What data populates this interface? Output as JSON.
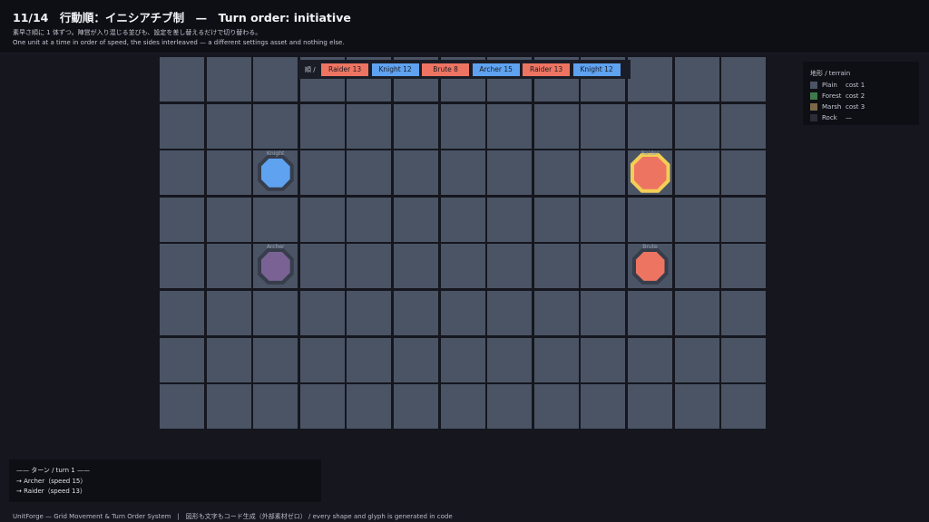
{
  "header": {
    "title": "11/14　行動順：イニシアチブ制　—　Turn order: initiative",
    "subtitle_ja": "素早さ順に 1 体ずつ。陣営が入り混じる並びも、設定を差し替えるだけで切り替わる。",
    "subtitle_en": "One unit at a time in order of speed, the sides interleaved — a different settings asset and nothing else."
  },
  "turn_order": {
    "label": "順 /",
    "queue": [
      {
        "name": "Raider",
        "speed": 13,
        "label": "Raider 13",
        "side": "enemy"
      },
      {
        "name": "Knight",
        "speed": 12,
        "label": "Knight 12",
        "side": "ally"
      },
      {
        "name": "Brute",
        "speed": 8,
        "label": "Brute 8",
        "side": "enemy"
      },
      {
        "name": "Archer",
        "speed": 15,
        "label": "Archer 15",
        "side": "ally"
      },
      {
        "name": "Raider",
        "speed": 13,
        "label": "Raider 13",
        "side": "enemy"
      },
      {
        "name": "Knight",
        "speed": 12,
        "label": "Knight 12",
        "side": "ally"
      }
    ]
  },
  "board": {
    "cols": 13,
    "rows": 8,
    "units": [
      {
        "name": "Knight",
        "col": 2,
        "row": 2,
        "side": "ally",
        "color": "#5ea2f0",
        "active": false
      },
      {
        "name": "Raider",
        "col": 10,
        "row": 2,
        "side": "enemy",
        "color": "#ee7462",
        "active": true
      },
      {
        "name": "Archer",
        "col": 2,
        "row": 4,
        "side": "ally",
        "color": "#7a6394",
        "active": false
      },
      {
        "name": "Brute",
        "col": 10,
        "row": 4,
        "side": "enemy",
        "color": "#ee7462",
        "active": false
      }
    ]
  },
  "legend": {
    "title": "地形 / terrain",
    "items": [
      {
        "name": "Plain",
        "cost": "cost 1",
        "color": "#4a5465"
      },
      {
        "name": "Forest",
        "cost": "cost 2",
        "color": "#3f7a4a"
      },
      {
        "name": "Marsh",
        "cost": "cost 3",
        "color": "#7c6848"
      },
      {
        "name": "Rock",
        "cost": "—",
        "color": "#2a2d38"
      }
    ]
  },
  "log": {
    "lines": [
      "—— ターン / turn 1 ——",
      "→ Archer（speed 15）",
      "→ Raider（speed 13）"
    ]
  },
  "footer": {
    "text": "UnitForge — Grid Movement & Turn Order System　|　図形も文字もコード生成（外部素材ゼロ） / every shape and glyph is generated in code"
  },
  "colors": {
    "background": "#15161e",
    "panel": "#0e0f15",
    "tile": "#4a5465",
    "ally": "#5ea2f0",
    "enemy": "#ee7462",
    "active_highlight": "#f2cf55"
  }
}
